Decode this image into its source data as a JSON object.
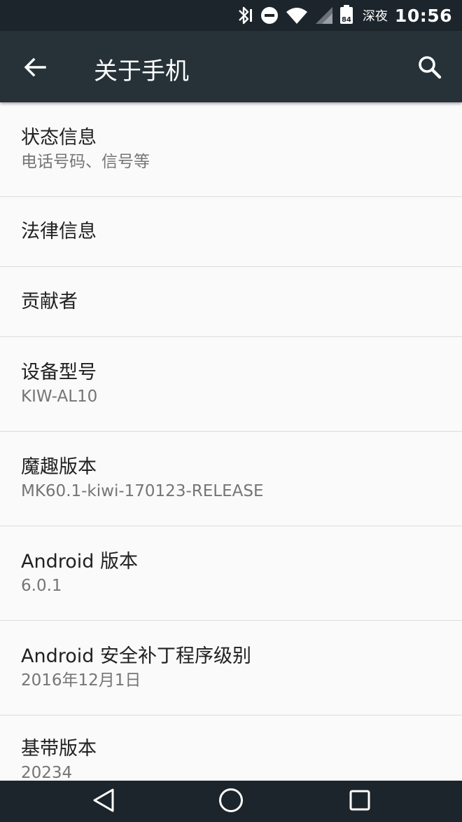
{
  "status_bar": {
    "battery_level": "84",
    "night_label": "深夜",
    "time": "10:56",
    "icons": [
      "bluetooth-icon",
      "do-not-disturb-icon",
      "wifi-icon",
      "cellular-signal-icon",
      "battery-icon"
    ]
  },
  "toolbar": {
    "title": "关于手机",
    "back_icon": "arrow-back-icon",
    "search_icon": "search-icon"
  },
  "items": [
    {
      "title": "状态信息",
      "summary": "电话号码、信号等"
    },
    {
      "title": "法律信息"
    },
    {
      "title": "贡献者"
    },
    {
      "title": "设备型号",
      "summary": "KIW-AL10"
    },
    {
      "title": "魔趣版本",
      "summary": "MK60.1-kiwi-170123-RELEASE"
    },
    {
      "title": "Android 版本",
      "summary": "6.0.1"
    },
    {
      "title": "Android 安全补丁程序级别",
      "summary": "2016年12月1日"
    },
    {
      "title": "基带版本",
      "summary": "20234"
    }
  ],
  "nav_bar": {
    "icons": [
      "back-triangle-icon",
      "home-circle-icon",
      "recents-square-icon"
    ]
  },
  "colors": {
    "status_bar": "#1c252b",
    "toolbar": "#263238",
    "background": "#fafafa",
    "divider": "#dcdcdc",
    "title_text": "#212121",
    "summary_text": "#757575"
  }
}
